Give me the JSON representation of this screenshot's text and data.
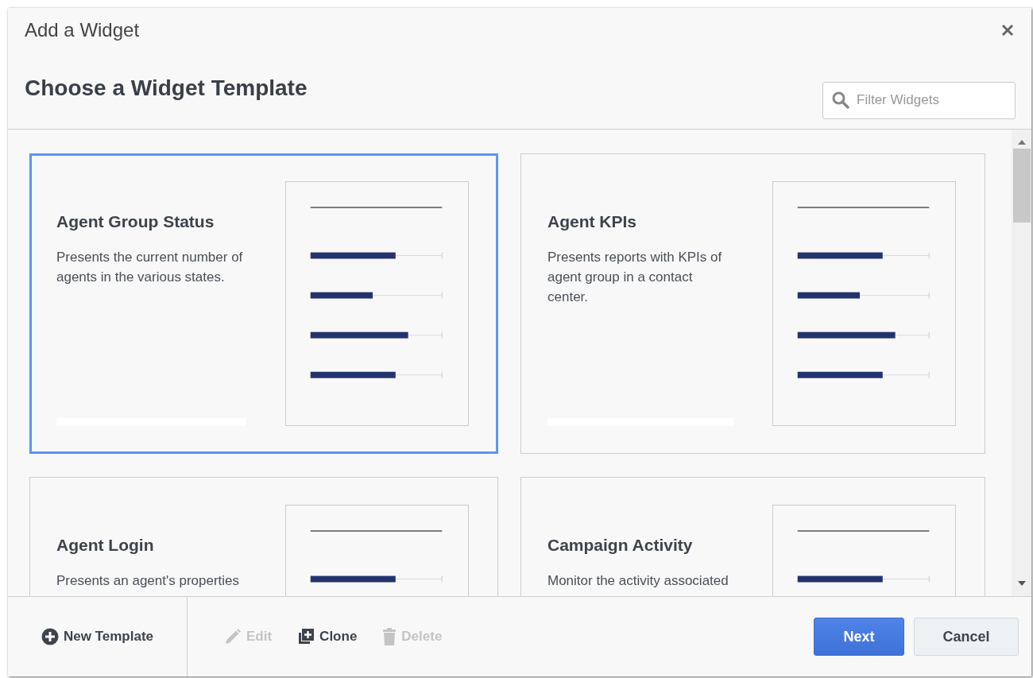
{
  "dialog": {
    "title": "Add a Widget",
    "heading": "Choose a Widget Template"
  },
  "search": {
    "placeholder": "Filter Widgets"
  },
  "cards": [
    {
      "title": "Agent Group Status",
      "description": "Presents the current number of agents in the various states.",
      "selected": true
    },
    {
      "title": "Agent KPIs",
      "description": "Presents reports with KPIs of agent group in a contact center.",
      "selected": false
    },
    {
      "title": "Agent Login",
      "description": "Presents an agent's properties",
      "selected": false
    },
    {
      "title": "Campaign Activity",
      "description": "Monitor the activity associated",
      "selected": false
    }
  ],
  "footer": {
    "actions": [
      {
        "kind": "new",
        "label": "New Template",
        "disabled": false
      },
      {
        "kind": "edit",
        "label": "Edit",
        "disabled": true
      },
      {
        "kind": "clone",
        "label": "Clone",
        "disabled": false
      },
      {
        "kind": "delete",
        "label": "Delete",
        "disabled": true
      }
    ],
    "buttons": [
      {
        "kind": "primary",
        "label": "Next"
      },
      {
        "kind": "secondary",
        "label": "Cancel"
      }
    ]
  }
}
